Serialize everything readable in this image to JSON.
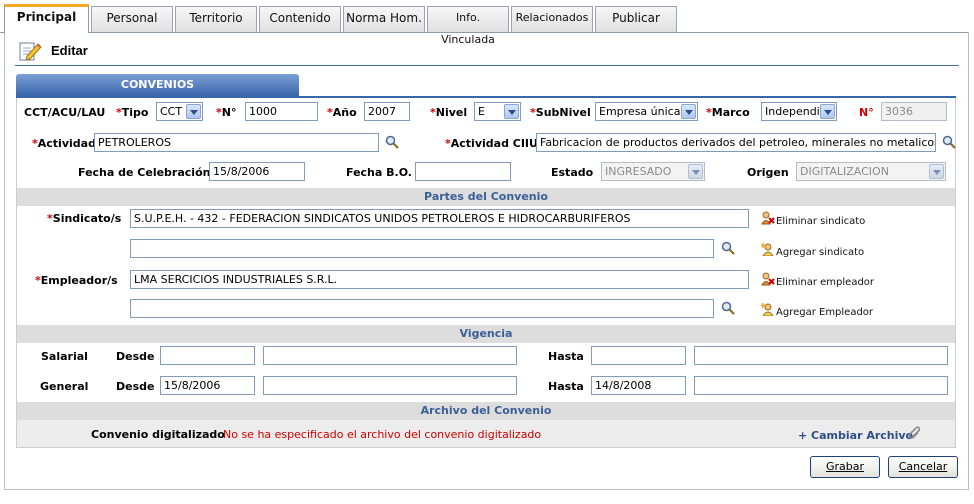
{
  "tabs": [
    {
      "label": "Principal",
      "active": true
    },
    {
      "label": "Personal"
    },
    {
      "label": "Territorio"
    },
    {
      "label": "Contenido"
    },
    {
      "label": "Norma Hom."
    },
    {
      "label": "Info. Vinculada"
    },
    {
      "label": "Relacionados"
    },
    {
      "label": "Publicar"
    }
  ],
  "header": {
    "title": "Editar",
    "icon": "edit-icon"
  },
  "section_tab": "CONVENIOS",
  "row1": {
    "cct_label": "CCT/ACU/LAU",
    "tipo_label": "Tipo",
    "tipo_value": "CCT",
    "numero_label": "N°",
    "numero_value": "1000",
    "anio_label": "Año",
    "anio_value": "2007",
    "nivel_label": "Nivel",
    "nivel_value": "E",
    "subnivel_label": "SubNivel",
    "subnivel_value": "Empresa única",
    "marco_label": "Marco",
    "marco_value": "Independie",
    "id_label": "N°",
    "id_value": "3036"
  },
  "row2": {
    "actividad_label": "Actividad",
    "actividad_value": "PETROLEROS",
    "ciiu_label": "Actividad CIIU",
    "ciiu_value": "Fabricacion de productos derivados del petroleo, minerales no metalicos y metales"
  },
  "row3": {
    "fecha_cel_label": "Fecha de Celebración",
    "fecha_cel_value": "15/8/2006",
    "fecha_bo_label": "Fecha B.O.",
    "fecha_bo_value": "",
    "estado_label": "Estado",
    "estado_value": "INGRESADO",
    "origen_label": "Origen",
    "origen_value": "DIGITALIZACION"
  },
  "partes": {
    "title": "Partes del Convenio",
    "sindicato_label": "Sindicato/s",
    "sindicato_value": "S.U.P.E.H. - 432 - FEDERACION SINDICATOS UNIDOS PETROLEROS E HIDROCARBURIFEROS",
    "eliminar_sindicato": "Eliminar sindicato",
    "agregar_sindicato": "Agregar sindicato",
    "empleador_label": "Empleador/s",
    "empleador_value": "LMA SERCICIOS INDUSTRIALES S.R.L.",
    "eliminar_empleador": "Eliminar empleador",
    "agregar_empleador": "Agregar Empleador"
  },
  "vigencia": {
    "title": "Vigencia",
    "salarial_label": "Salarial",
    "general_label": "General",
    "desde_label": "Desde",
    "hasta_label": "Hasta",
    "salarial_desde": "",
    "salarial_desde_text": "",
    "salarial_hasta": "",
    "salarial_hasta_text": "",
    "general_desde": "15/8/2006",
    "general_desde_text": "",
    "general_hasta": "14/8/2008",
    "general_hasta_text": ""
  },
  "archivo": {
    "title": "Archivo del Convenio",
    "label": "Convenio digitalizado",
    "message": "No se ha especificado el archivo del convenio digitalizado",
    "cambiar": "+ Cambiar Archivo"
  },
  "buttons": {
    "grabar": "Grabar",
    "cancelar": "Cancelar"
  },
  "colors": {
    "accent": "#3a66ac",
    "required": "#d00000",
    "tab_active": "#f7a823"
  }
}
